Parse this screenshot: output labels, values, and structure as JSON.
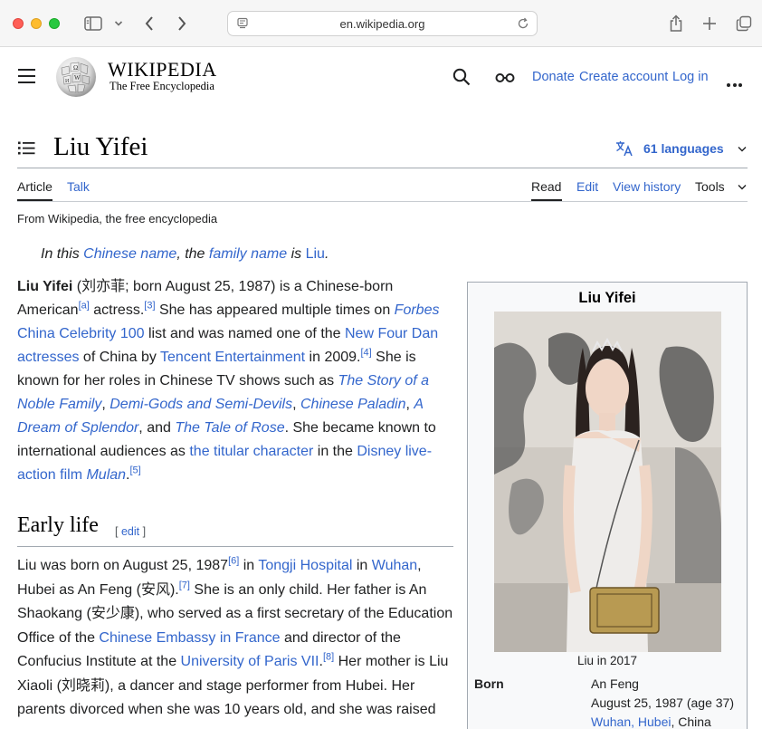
{
  "browser": {
    "url": "en.wikipedia.org"
  },
  "header": {
    "wordmark": "WIKIPEDIA",
    "tagline": "The Free Encyclopedia",
    "links": [
      "Donate",
      "Create account",
      "Log in"
    ]
  },
  "page": {
    "title": "Liu Yifei",
    "languages": "61 languages",
    "tabs_left": [
      "Article",
      "Talk"
    ],
    "tabs_right": [
      "Read",
      "Edit",
      "View history",
      "Tools"
    ],
    "from_wikipedia": "From Wikipedia, the free encyclopedia"
  },
  "hatnote": {
    "t1": "In this ",
    "l1": "Chinese name",
    "t2": ", the ",
    "l2": "family name",
    "t3": " is ",
    "l3": "Liu",
    "t4": "."
  },
  "intro": {
    "bold_name": "Liu Yifei",
    "t1": " (刘亦菲; born August 25, 1987) is a Chinese-born American",
    "ref_a": "[a]",
    "t2": " actress.",
    "ref_3": "[3]",
    "t3": " She has appeared multiple times on ",
    "l_forbes": "Forbes",
    "l_forbes2": "China Celebrity 100",
    "t4": " list and was named one of the ",
    "l_dan": "New Four Dan actresses",
    "t5": " of China by ",
    "l_tencent": "Tencent Entertainment",
    "t6": " in 2009.",
    "ref_4": "[4]",
    "t7": " She is known for her roles in Chinese TV shows such as ",
    "l_story": "The Story of a Noble Family",
    "t8": ", ",
    "l_demi": "Demi-Gods and Semi-Devils",
    "t9": ", ",
    "l_paladin": "Chinese Paladin",
    "t10": ", ",
    "l_dream": "A Dream of Splendor",
    "t11": ", and ",
    "l_rose": "The Tale of Rose",
    "t12": ". She became known to international audiences as ",
    "l_titular": "the titular character",
    "t13": " in the ",
    "l_disney": "Disney live-action film ",
    "l_mulan": "Mulan",
    "t14": ".",
    "ref_5": "[5]"
  },
  "early_life": {
    "heading": "Early life",
    "edit": "edit",
    "t1": "Liu was born on August 25, 1987",
    "ref_6": "[6]",
    "t2": " in ",
    "l_tongji": "Tongji Hospital",
    "t3": " in ",
    "l_wuhan": "Wuhan",
    "t4": ", Hubei as An Feng (安风).",
    "ref_7": "[7]",
    "t5": " She is an only child. Her father is An Shaokang (安少康), who served as a first secretary of the Education Office of the ",
    "l_embassy": "Chinese Embassy in France",
    "t6": " and director of the Confucius Institute at the ",
    "l_paris": "University of Paris VII",
    "t7": ".",
    "ref_8": "[8]",
    "t8": " Her mother is Liu Xiaoli (刘晓莉), a dancer and stage performer from Hubei. Her parents divorced when she was 10 years old, and she was raised"
  },
  "infobox": {
    "title": "Liu Yifei",
    "caption": "Liu in 2017",
    "born_label": "Born",
    "born_name": "An Feng",
    "born_date": "August 25, 1987 (age 37)",
    "born_place_link": "Wuhan, Hubei",
    "born_place_rest": ", China"
  },
  "colors": {
    "link": "#3366cc",
    "text": "#202122"
  }
}
